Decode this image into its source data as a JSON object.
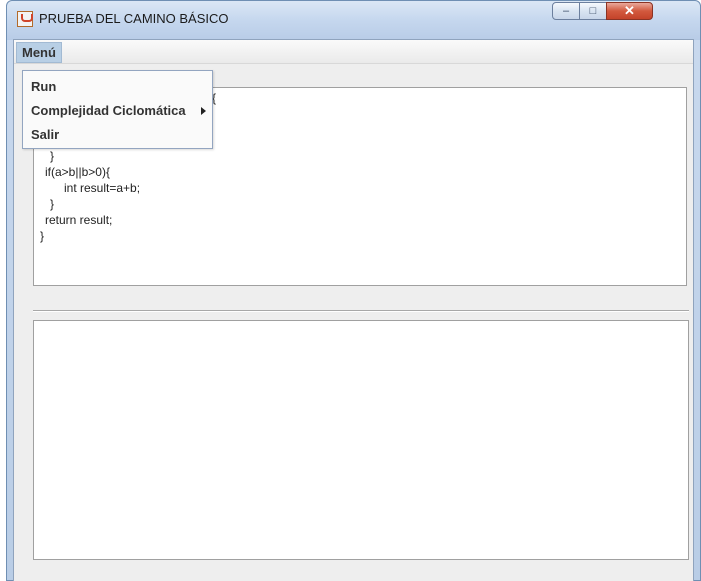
{
  "window": {
    "title": "PRUEBA DEL CAMINO BÁSICO",
    "controls": {
      "minimize": "–",
      "maximize": "□",
      "close": "✕"
    }
  },
  "menubar": {
    "menu_label": "Menú"
  },
  "dropdown": {
    "items": [
      {
        "label": "Run"
      },
      {
        "label": "Complejidad Ciclomática"
      },
      {
        "label": "Salir"
      }
    ]
  },
  "code": {
    "lines": [
      "{",
      "}",
      "if(a>b||b>0){",
      "int result=a+b;",
      "}",
      "return result;",
      "}"
    ]
  },
  "colors": {
    "menu_highlight": "#b8cfe5",
    "close_button": "#c4432a",
    "titlebar": "#c5d7ee"
  }
}
